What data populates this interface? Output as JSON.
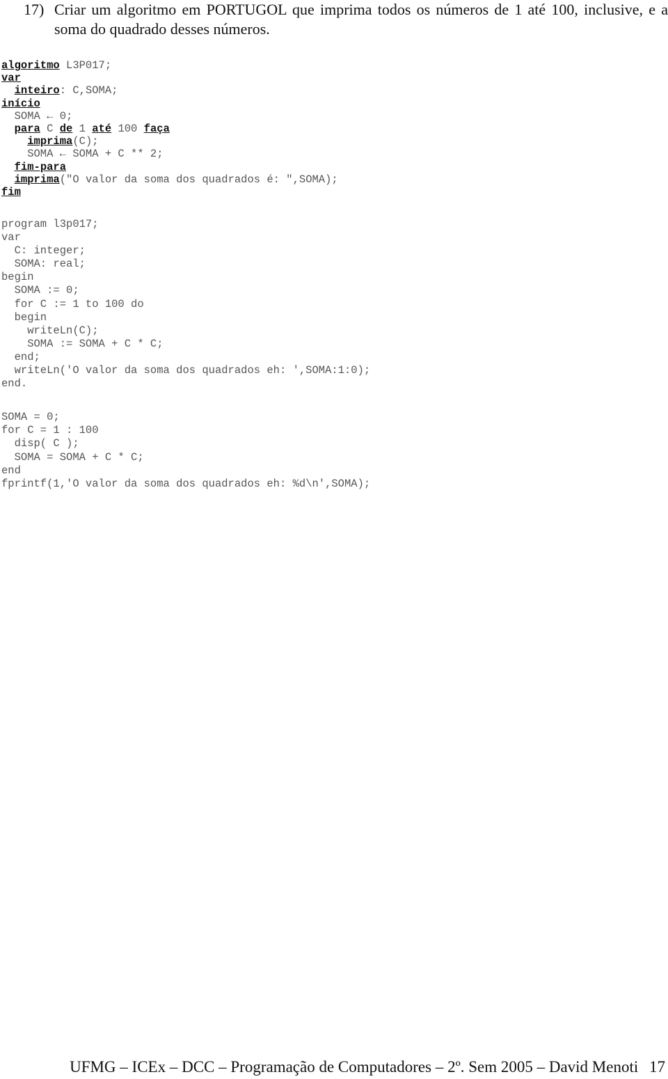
{
  "question": {
    "number": "17)",
    "text": "Criar um algoritmo em PORTUGOL que imprima todos os números de 1 até 100, inclusive, e a soma do quadrado desses números."
  },
  "portugol": {
    "lines": [
      [
        {
          "t": "algoritmo",
          "kw": true
        },
        {
          "t": " L3P017;"
        }
      ],
      [
        {
          "t": "var",
          "kw": true
        }
      ],
      [
        {
          "t": "  "
        },
        {
          "t": "inteiro",
          "kw": true
        },
        {
          "t": ": C,SOMA;"
        }
      ],
      [
        {
          "t": "início",
          "kw": true
        }
      ],
      [
        {
          "t": "  SOMA ← 0;"
        }
      ],
      [
        {
          "t": "  "
        },
        {
          "t": "para",
          "kw": true
        },
        {
          "t": " C "
        },
        {
          "t": "de",
          "kw": true
        },
        {
          "t": " 1 "
        },
        {
          "t": "até",
          "kw": true
        },
        {
          "t": " 100 "
        },
        {
          "t": "faça",
          "kw": true
        }
      ],
      [
        {
          "t": "    "
        },
        {
          "t": "imprima",
          "kw": true
        },
        {
          "t": "(C);"
        }
      ],
      [
        {
          "t": "    SOMA ← SOMA + C ** 2;"
        }
      ],
      [
        {
          "t": "  "
        },
        {
          "t": "fim-para",
          "kw": true
        }
      ],
      [
        {
          "t": "  "
        },
        {
          "t": "imprima",
          "kw": true
        },
        {
          "t": "(\"O valor da soma dos quadrados é: \",SOMA);"
        }
      ],
      [
        {
          "t": "fim",
          "kw": true
        }
      ]
    ]
  },
  "pascal": {
    "lines": [
      "program l3p017;",
      "var",
      "  C: integer;",
      "  SOMA: real;",
      "begin",
      "  SOMA := 0;",
      "  for C := 1 to 100 do",
      "  begin",
      "    writeLn(C);",
      "    SOMA := SOMA + C * C;",
      "  end;",
      "  writeLn('O valor da soma dos quadrados eh: ',SOMA:1:0);",
      "end."
    ]
  },
  "matlab": {
    "lines": [
      "SOMA = 0;",
      "for C = 1 : 100",
      "  disp( C );",
      "  SOMA = SOMA + C * C;",
      "end",
      "fprintf(1,'O valor da soma dos quadrados eh: %d\\n',SOMA);"
    ]
  },
  "footer": {
    "text": "UFMG – ICEx – DCC – Programação de Computadores – 2º. Sem 2005 – David Menoti",
    "page_number": "17"
  }
}
